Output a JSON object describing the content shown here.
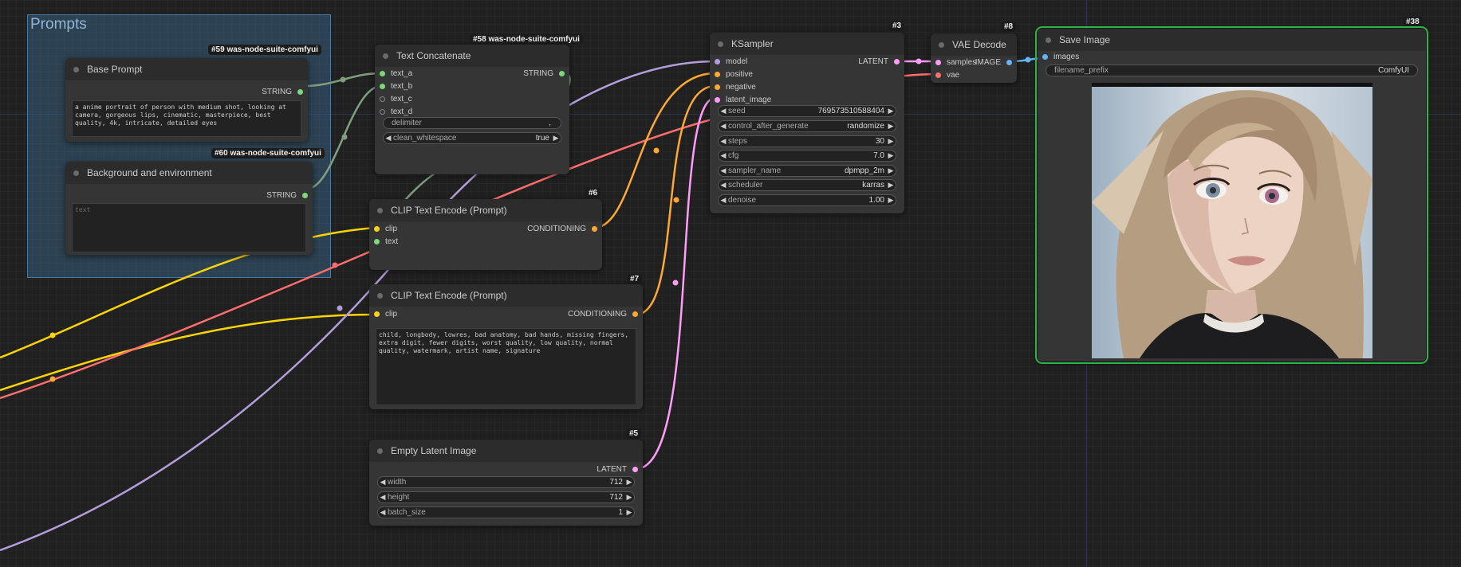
{
  "group": {
    "title": "Prompts"
  },
  "nodes": {
    "base_prompt": {
      "badge": "#59 was-node-suite-comfyui",
      "title": "Base Prompt",
      "output": "STRING",
      "text": "a anime portrait of person with medium shot, looking at camera, gorgeous lips, cinematic, masterpiece, best quality, 4k, intricate, detailed eyes"
    },
    "background": {
      "badge": "#60 was-node-suite-comfyui",
      "title": "Background and environment",
      "output": "STRING",
      "placeholder": "text"
    },
    "concat": {
      "badge": "#58 was-node-suite-comfyui",
      "title": "Text Concatenate",
      "inputs": [
        "text_a",
        "text_b",
        "text_c",
        "text_d"
      ],
      "output": "STRING",
      "delimiter_label": "delimiter",
      "delimiter_value": ",",
      "clean_label": "clean_whitespace",
      "clean_value": "true"
    },
    "clip6": {
      "badge": "#6",
      "title": "CLIP Text Encode (Prompt)",
      "inputs": [
        "clip",
        "text"
      ],
      "output": "CONDITIONING"
    },
    "clip7": {
      "badge": "#7",
      "title": "CLIP Text Encode (Prompt)",
      "inputs": [
        "clip"
      ],
      "output": "CONDITIONING",
      "text": "child, longbody, lowres, bad anatomy, bad hands, missing fingers, extra digit, fewer digits, worst quality, low quality, normal quality, watermark, artist name, signature"
    },
    "latent": {
      "badge": "#5",
      "title": "Empty Latent Image",
      "output": "LATENT",
      "widgets": [
        {
          "label": "width",
          "value": "712"
        },
        {
          "label": "height",
          "value": "712"
        },
        {
          "label": "batch_size",
          "value": "1"
        }
      ]
    },
    "ksampler": {
      "badge": "#3",
      "title": "KSampler",
      "inputs": [
        "model",
        "positive",
        "negative",
        "latent_image"
      ],
      "output": "LATENT",
      "widgets": [
        {
          "label": "seed",
          "value": "769573510588404"
        },
        {
          "label": "control_after_generate",
          "value": "randomize"
        },
        {
          "label": "steps",
          "value": "30"
        },
        {
          "label": "cfg",
          "value": "7.0"
        },
        {
          "label": "sampler_name",
          "value": "dpmpp_2m"
        },
        {
          "label": "scheduler",
          "value": "karras"
        },
        {
          "label": "denoise",
          "value": "1.00"
        }
      ]
    },
    "vae": {
      "badge": "#8",
      "title": "VAE Decode",
      "inputs": [
        "samples",
        "vae"
      ],
      "output": "IMAGE"
    },
    "save": {
      "badge": "#38",
      "title": "Save Image",
      "inputs": [
        "images"
      ],
      "filename_label": "filename_prefix",
      "filename_value": "ComfyUI"
    }
  },
  "colors": {
    "clip": "#ffd500",
    "conditioning": "#ffa931",
    "latent": "#ff9cf9",
    "model": "#b39ddb",
    "vae": "#ff6e6e",
    "image": "#64b5f6",
    "string": "#7cd97c"
  },
  "icons": [
    "arrow-left-icon",
    "arrow-right-icon",
    "slot-dot-icon",
    "status-dot-icon"
  ]
}
